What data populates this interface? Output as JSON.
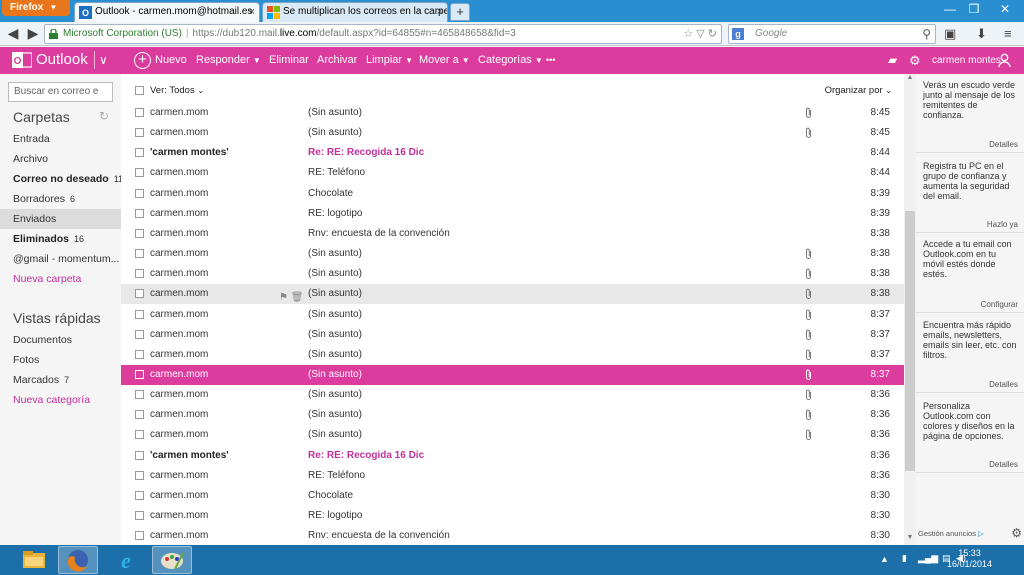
{
  "browser": {
    "menu_label": "Firefox",
    "tabs": [
      {
        "label": "Outlook - carmen.mom@hotmail.es",
        "active": true
      },
      {
        "label": "Se multiplican los correos en la carpe...",
        "active": false
      }
    ],
    "url": {
      "org": "Microsoft Corporation (US)",
      "scheme": "https://",
      "host_pre": "dub120.mail.",
      "host": "live.com",
      "path": "/default.aspx?id=64855#n=465848658&fid=3"
    },
    "search_placeholder": "Google"
  },
  "outlook": {
    "brand": "Outlook",
    "toolbar": {
      "new": "Nuevo",
      "reply": "Responder",
      "delete": "Eliminar",
      "archive": "Archivar",
      "sweep": "Limpiar",
      "move": "Mover a",
      "categories": "Categorías",
      "more": "•••"
    },
    "user_name": "carmen montes",
    "accent": "#dc3c9e"
  },
  "sidebar": {
    "search_placeholder": "Buscar en correo e",
    "folders_title": "Carpetas",
    "folders": [
      {
        "label": "Entrada",
        "count": "",
        "bold": false,
        "selected": false
      },
      {
        "label": "Archivo",
        "count": "",
        "bold": false,
        "selected": false
      },
      {
        "label": "Correo no deseado",
        "count": "11",
        "bold": true,
        "selected": false
      },
      {
        "label": "Borradores",
        "count": "6",
        "bold": false,
        "selected": false
      },
      {
        "label": "Enviados",
        "count": "",
        "bold": false,
        "selected": true
      },
      {
        "label": "Eliminados",
        "count": "16",
        "bold": true,
        "selected": false
      },
      {
        "label": "@gmail - momentum...",
        "count": "",
        "bold": false,
        "selected": false
      }
    ],
    "new_folder": "Nueva carpeta",
    "quick_title": "Vistas rápidas",
    "quick": [
      {
        "label": "Documentos",
        "count": ""
      },
      {
        "label": "Fotos",
        "count": ""
      },
      {
        "label": "Marcados",
        "count": "7"
      }
    ],
    "new_category": "Nueva categoría"
  },
  "list": {
    "view_label": "Ver: Todos",
    "sort_label": "Organizar por",
    "rows": [
      {
        "from": "carmen.mom",
        "subject": "(Sin asunto)",
        "time": "8:45",
        "attach": true,
        "unread": false,
        "state": ""
      },
      {
        "from": "carmen.mom",
        "subject": "(Sin asunto)",
        "time": "8:45",
        "attach": true,
        "unread": false,
        "state": ""
      },
      {
        "from": "'carmen montes'",
        "subject": "Re: RE: Recogida 16 Dic",
        "time": "8:44",
        "attach": false,
        "unread": true,
        "state": ""
      },
      {
        "from": "carmen.mom",
        "subject": "RE: Teléfono",
        "time": "8:44",
        "attach": false,
        "unread": false,
        "state": ""
      },
      {
        "from": "carmen.mom",
        "subject": "Chocolate",
        "time": "8:39",
        "attach": false,
        "unread": false,
        "state": ""
      },
      {
        "from": "carmen.mom",
        "subject": "RE: logotipo",
        "time": "8:39",
        "attach": false,
        "unread": false,
        "state": ""
      },
      {
        "from": "carmen.mom",
        "subject": "Rnv: encuesta de la convención",
        "time": "8:38",
        "attach": false,
        "unread": false,
        "state": ""
      },
      {
        "from": "carmen.mom",
        "subject": "(Sin asunto)",
        "time": "8:38",
        "attach": true,
        "unread": false,
        "state": ""
      },
      {
        "from": "carmen.mom",
        "subject": "(Sin asunto)",
        "time": "8:38",
        "attach": true,
        "unread": false,
        "state": ""
      },
      {
        "from": "carmen.mom",
        "subject": "(Sin asunto)",
        "time": "8:38",
        "attach": true,
        "unread": false,
        "state": "hover"
      },
      {
        "from": "carmen.mom",
        "subject": "(Sin asunto)",
        "time": "8:37",
        "attach": true,
        "unread": false,
        "state": ""
      },
      {
        "from": "carmen.mom",
        "subject": "(Sin asunto)",
        "time": "8:37",
        "attach": true,
        "unread": false,
        "state": ""
      },
      {
        "from": "carmen.mom",
        "subject": "(Sin asunto)",
        "time": "8:37",
        "attach": true,
        "unread": false,
        "state": ""
      },
      {
        "from": "carmen.mom",
        "subject": "(Sin asunto)",
        "time": "8:37",
        "attach": true,
        "unread": false,
        "state": "selected"
      },
      {
        "from": "carmen.mom",
        "subject": "(Sin asunto)",
        "time": "8:36",
        "attach": true,
        "unread": false,
        "state": ""
      },
      {
        "from": "carmen.mom",
        "subject": "(Sin asunto)",
        "time": "8:36",
        "attach": true,
        "unread": false,
        "state": ""
      },
      {
        "from": "carmen.mom",
        "subject": "(Sin asunto)",
        "time": "8:36",
        "attach": true,
        "unread": false,
        "state": ""
      },
      {
        "from": "'carmen montes'",
        "subject": "Re: RE: Recogida 16 Dic",
        "time": "8:36",
        "attach": false,
        "unread": true,
        "state": ""
      },
      {
        "from": "carmen.mom",
        "subject": "RE: Teléfono",
        "time": "8:36",
        "attach": false,
        "unread": false,
        "state": ""
      },
      {
        "from": "carmen.mom",
        "subject": "Chocolate",
        "time": "8:30",
        "attach": false,
        "unread": false,
        "state": ""
      },
      {
        "from": "carmen.mom",
        "subject": "RE: logotipo",
        "time": "8:30",
        "attach": false,
        "unread": false,
        "state": ""
      },
      {
        "from": "carmen.mom",
        "subject": "Rnv: encuesta de la convención",
        "time": "8:30",
        "attach": false,
        "unread": false,
        "state": ""
      }
    ]
  },
  "ads": [
    {
      "text": "Verás un escudo verde junto al mensaje de los remitentes de confianza.",
      "link": "Detalles"
    },
    {
      "text": "Registra tu PC en el grupo de confianza y aumenta la seguridad del email.",
      "link": "Hazlo ya"
    },
    {
      "text": "Accede a tu email con Outlook.com en tu móvil estés donde estés.",
      "link": "Configurar"
    },
    {
      "text": "Encuentra más rápido emails, newsletters, emails sin leer, etc. con filtros.",
      "link": "Detalles"
    },
    {
      "text": "Personaliza Outlook.com con colores y diseños en la página de opciones.",
      "link": "Detalles"
    }
  ],
  "ads_footer": "Gestión anuncios",
  "taskbar": {
    "time": "15:33",
    "date": "16/01/2014"
  }
}
